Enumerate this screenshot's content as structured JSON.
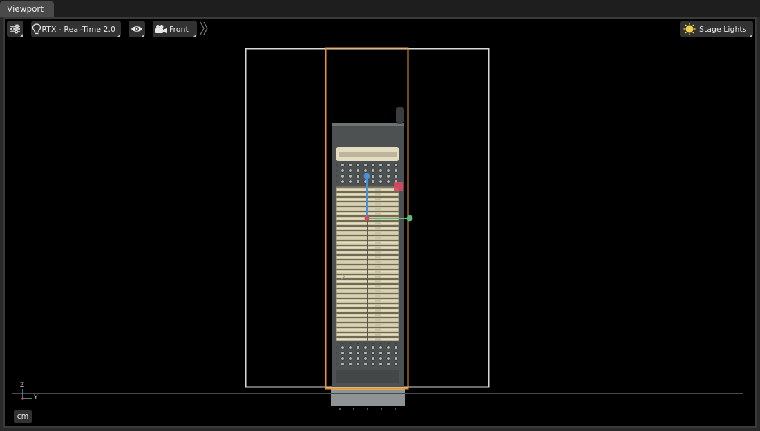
{
  "tabs": [
    {
      "label": "Viewport"
    }
  ],
  "toolbar": {
    "settings_icon": "sliders-icon",
    "renderer": {
      "icon": "lightbulb-icon",
      "label": "RTX - Real-Time 2.0"
    },
    "visibility": {
      "icon": "eye-icon"
    },
    "camera": {
      "icon": "camera-icon",
      "label": "Front"
    },
    "expand": {
      "icon": "double-chevron-right-icon"
    },
    "lighting": {
      "icon": "sun-icon",
      "label": "Stage Lights"
    }
  },
  "axes": {
    "vertical": "Z",
    "horizontal": "Y"
  },
  "units": {
    "label": "cm"
  },
  "colors": {
    "selection": "#e8962a",
    "bounds": "#d8d8d8",
    "gizmo_x": "#d9495e",
    "gizmo_y": "#5fb87a",
    "gizmo_z": "#4a8fd9"
  }
}
